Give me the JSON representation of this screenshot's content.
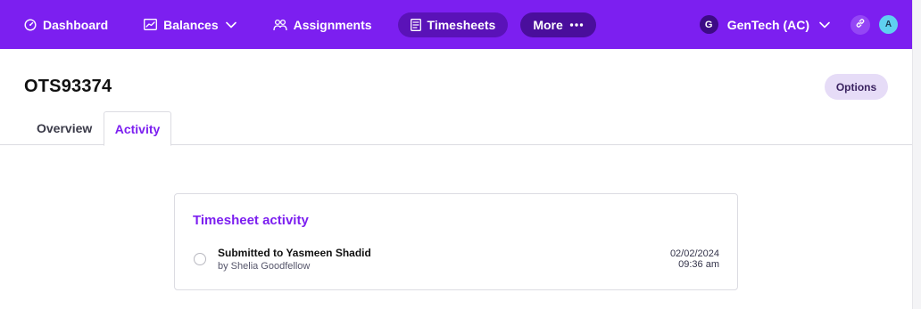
{
  "nav": {
    "items": [
      {
        "label": "Dashboard",
        "icon": "gauge-icon"
      },
      {
        "label": "Balances",
        "icon": "chart-line-icon"
      },
      {
        "label": "Assignments",
        "icon": "people-icon"
      },
      {
        "label": "Timesheets",
        "icon": "document-icon",
        "active": true
      },
      {
        "label": "More",
        "icon": "more-dots-icon"
      }
    ],
    "org": {
      "initial": "G",
      "name": "GenTech (AC)"
    },
    "user_initial": "A"
  },
  "header": {
    "title": "OTS93374",
    "options_label": "Options"
  },
  "tabs": [
    {
      "label": "Overview"
    },
    {
      "label": "Activity",
      "active": true
    }
  ],
  "activity": {
    "title": "Timesheet activity",
    "events": [
      {
        "title": "Submitted to Yasmeen Shadid",
        "by": "by Shelia Goodfellow",
        "date": "02/02/2024",
        "time": "09:36 am"
      }
    ]
  },
  "colors": {
    "brand": "#7c1ff0",
    "nav_active": "#5a12b8",
    "options_bg": "#e6dcf7"
  }
}
